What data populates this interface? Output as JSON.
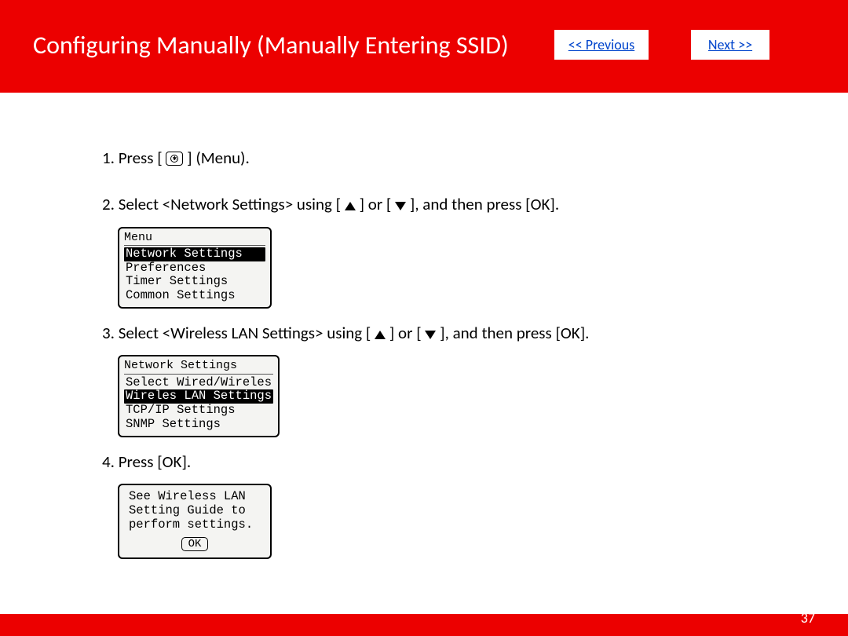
{
  "header": {
    "title": "Configuring Manually (Manually Entering SSID)",
    "prev_label": "<< Previous",
    "next_label": "Next >>"
  },
  "steps": {
    "s1_a": "1. Press [",
    "s1_b": "] (Menu).",
    "s2_a": "2. Select <Network Settings> using [",
    "s2_b": "] or [",
    "s2_c": "], and then press [OK].",
    "s3_a": "3. Select <Wireless LAN Settings> using [",
    "s3_b": "] or [",
    "s3_c": "], and then press [OK].",
    "s4": "4. Press [OK]."
  },
  "lcd1": {
    "title": "Menu",
    "lines": [
      "Network Settings",
      "Preferences",
      "Timer Settings",
      "Common Settings"
    ],
    "selected": 0
  },
  "lcd2": {
    "title": "Network Settings",
    "lines": [
      "Select Wired/Wireles",
      "Wireles LAN Settings",
      "TCP/IP Settings",
      "SNMP Settings"
    ],
    "selected": 1
  },
  "lcd3": {
    "lines": [
      "See Wireless LAN",
      "Setting Guide to",
      "perform settings."
    ],
    "ok": "OK"
  },
  "page_number": "37"
}
